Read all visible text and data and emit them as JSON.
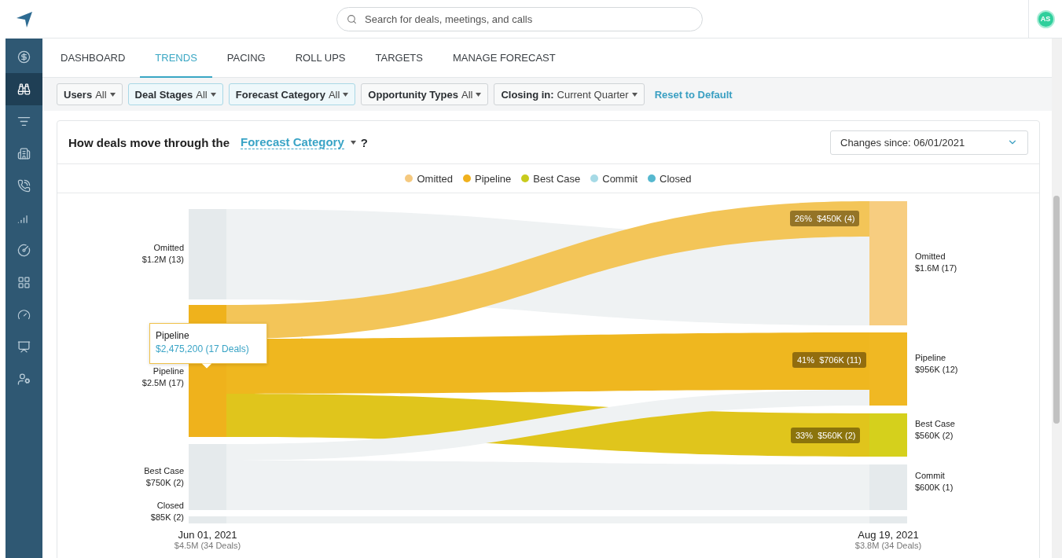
{
  "sidebar": {
    "items": [
      {
        "selected": false
      },
      {
        "selected": true
      },
      {
        "selected": false
      },
      {
        "selected": false
      },
      {
        "selected": false
      },
      {
        "selected": false
      },
      {
        "selected": false
      },
      {
        "selected": false
      },
      {
        "selected": false
      },
      {
        "selected": false
      },
      {
        "selected": false
      }
    ]
  },
  "search": {
    "placeholder": "Search for deals, meetings, and calls"
  },
  "avatar": {
    "initials": "AS"
  },
  "tabs": [
    {
      "label": "DASHBOARD",
      "selected": false
    },
    {
      "label": "TRENDS",
      "selected": true
    },
    {
      "label": "PACING",
      "selected": false
    },
    {
      "label": "ROLL UPS",
      "selected": false
    },
    {
      "label": "TARGETS",
      "selected": false
    },
    {
      "label": "MANAGE FORECAST",
      "selected": false
    }
  ],
  "filters": [
    {
      "label": "Users",
      "value": "All",
      "selected": false
    },
    {
      "label": "Deal Stages",
      "value": "All",
      "selected": true
    },
    {
      "label": "Forecast Category",
      "value": "All",
      "selected": true
    },
    {
      "label": "Opportunity Types",
      "value": "All",
      "selected": false
    },
    {
      "label": "Closing in:",
      "value": "Current Quarter",
      "selected": false
    }
  ],
  "reset_link": "Reset to Default",
  "card": {
    "title": "How deals move through the",
    "dimension": "Forecast Category",
    "question": "?",
    "changes_since": "Changes since: 06/01/2021",
    "legend": [
      {
        "label": "Omitted",
        "color": "#f5c97f"
      },
      {
        "label": "Pipeline",
        "color": "#f0b11e"
      },
      {
        "label": "Best Case",
        "color": "#c8cb1d"
      },
      {
        "label": "Commit",
        "color": "#a6dae6"
      },
      {
        "label": "Closed",
        "color": "#56b8cf"
      }
    ],
    "flow_chart": {
      "left_nodes": [
        {
          "label": "Omitted",
          "value": "$1.2M (13)",
          "color": "#e5eaec"
        },
        {
          "label": "Pipeline",
          "value": "$2.5M (17)",
          "color": "#efb21c"
        },
        {
          "label": "Best Case",
          "value": "$750K (2)",
          "color": "#e5eaec"
        },
        {
          "label": "Closed",
          "value": "$85K (2)",
          "color": "#e5eaec"
        }
      ],
      "right_nodes": [
        {
          "label": "Omitted",
          "value": "$1.6M (17)",
          "color": "#f7cd80"
        },
        {
          "label": "Pipeline",
          "value": "$956K (12)",
          "color": "#f0b823"
        },
        {
          "label": "Best Case",
          "value": "$560K (2)",
          "color": "#d5d01c"
        },
        {
          "label": "Commit",
          "value": "$600K (1)",
          "color": "#e5eaec"
        },
        {
          "color": "#e5eaec"
        }
      ],
      "flows": [
        {
          "color": "#eff2f3"
        },
        {
          "color": "#f3c558",
          "badge": "26%  $450K (4)"
        },
        {
          "color": "#efb71f",
          "badge": "41%  $706K (11)"
        },
        {
          "color": "#e0c51c",
          "badge": "33%  $560K (2)"
        },
        {
          "color": "#eff2f3"
        },
        {
          "color": "#eff2f3"
        },
        {
          "color": "#eff2f3"
        }
      ],
      "tooltip": {
        "title": "Pipeline",
        "value": "$2,475,200 (17 Deals)"
      },
      "start": {
        "date": "Jun 01, 2021",
        "total": "$4.5M (34 Deals)"
      },
      "end": {
        "date": "Aug 19, 2021",
        "total": "$3.8M (34 Deals)"
      }
    }
  }
}
